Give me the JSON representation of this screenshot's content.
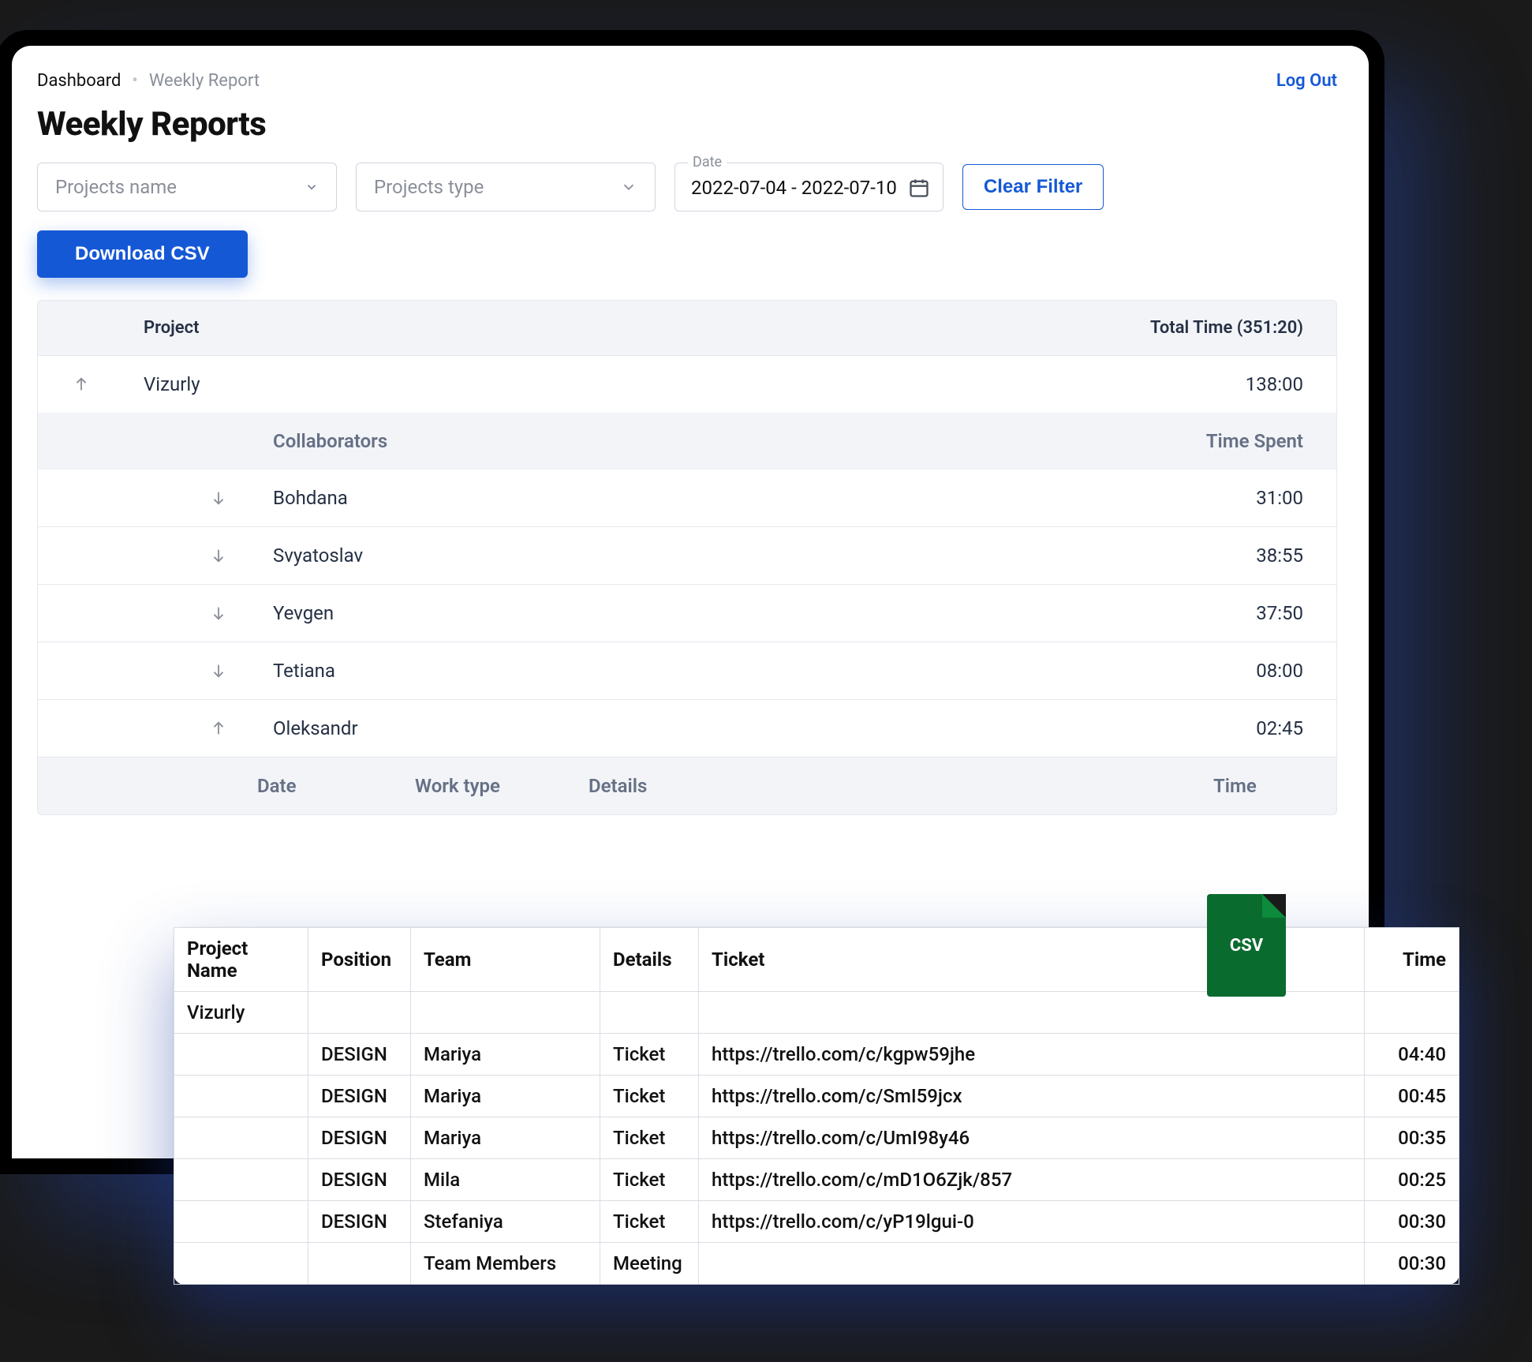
{
  "breadcrumb": {
    "home": "Dashboard",
    "current": "Weekly Report"
  },
  "logout_label": "Log Out",
  "page_title": "Weekly Reports",
  "filters": {
    "project_name_placeholder": "Projects name",
    "project_type_placeholder": "Projects type",
    "date_label": "Date",
    "date_value": "2022-07-04 - 2022-07-10",
    "clear_label": "Clear Filter"
  },
  "download_label": "Download CSV",
  "table": {
    "project_header": "Project",
    "total_time_header": "Total Time (351:20)",
    "project_name": "Vizurly",
    "project_time": "138:00",
    "collaborators_header": "Collaborators",
    "time_spent_header": "Time Spent",
    "collaborators": [
      {
        "name": "Bohdana",
        "time": "31:00",
        "dir": "down"
      },
      {
        "name": "Svyatoslav",
        "time": "38:55",
        "dir": "down"
      },
      {
        "name": "Yevgen",
        "time": "37:50",
        "dir": "down"
      },
      {
        "name": "Tetiana",
        "time": "08:00",
        "dir": "down"
      },
      {
        "name": "Oleksandr",
        "time": "02:45",
        "dir": "up"
      }
    ],
    "detail_headers": {
      "date": "Date",
      "work_type": "Work type",
      "details": "Details",
      "time": "Time"
    }
  },
  "csv": {
    "badge_label": "CSV",
    "headers": {
      "project_name": "Project Name",
      "position": "Position",
      "team": "Team",
      "details": "Details",
      "ticket": "Ticket",
      "time": "Time"
    },
    "rows": [
      {
        "project_name": "Vizurly",
        "position": "",
        "team": "",
        "details": "",
        "ticket": "",
        "time": ""
      },
      {
        "project_name": "",
        "position": "DESIGN",
        "team": "Mariya",
        "details": "Ticket",
        "ticket": "https://trello.com/c/kgpw59jhe",
        "time": "04:40"
      },
      {
        "project_name": "",
        "position": "DESIGN",
        "team": "Mariya",
        "details": "Ticket",
        "ticket": "https://trello.com/c/SmI59jcx",
        "time": "00:45"
      },
      {
        "project_name": "",
        "position": "DESIGN",
        "team": "Mariya",
        "details": "Ticket",
        "ticket": "https://trello.com/c/UmI98y46",
        "time": "00:35"
      },
      {
        "project_name": "",
        "position": "DESIGN",
        "team": "Mila",
        "details": "Ticket",
        "ticket": "https://trello.com/c/mD1O6Zjk/857",
        "time": "00:25"
      },
      {
        "project_name": "",
        "position": "DESIGN",
        "team": "Stefaniya",
        "details": "Ticket",
        "ticket": "https://trello.com/c/yP19lgui-0",
        "time": "00:30"
      },
      {
        "project_name": "",
        "position": "",
        "team": "Team Members",
        "details": "Meeting",
        "ticket": "",
        "time": "00:30"
      }
    ]
  }
}
